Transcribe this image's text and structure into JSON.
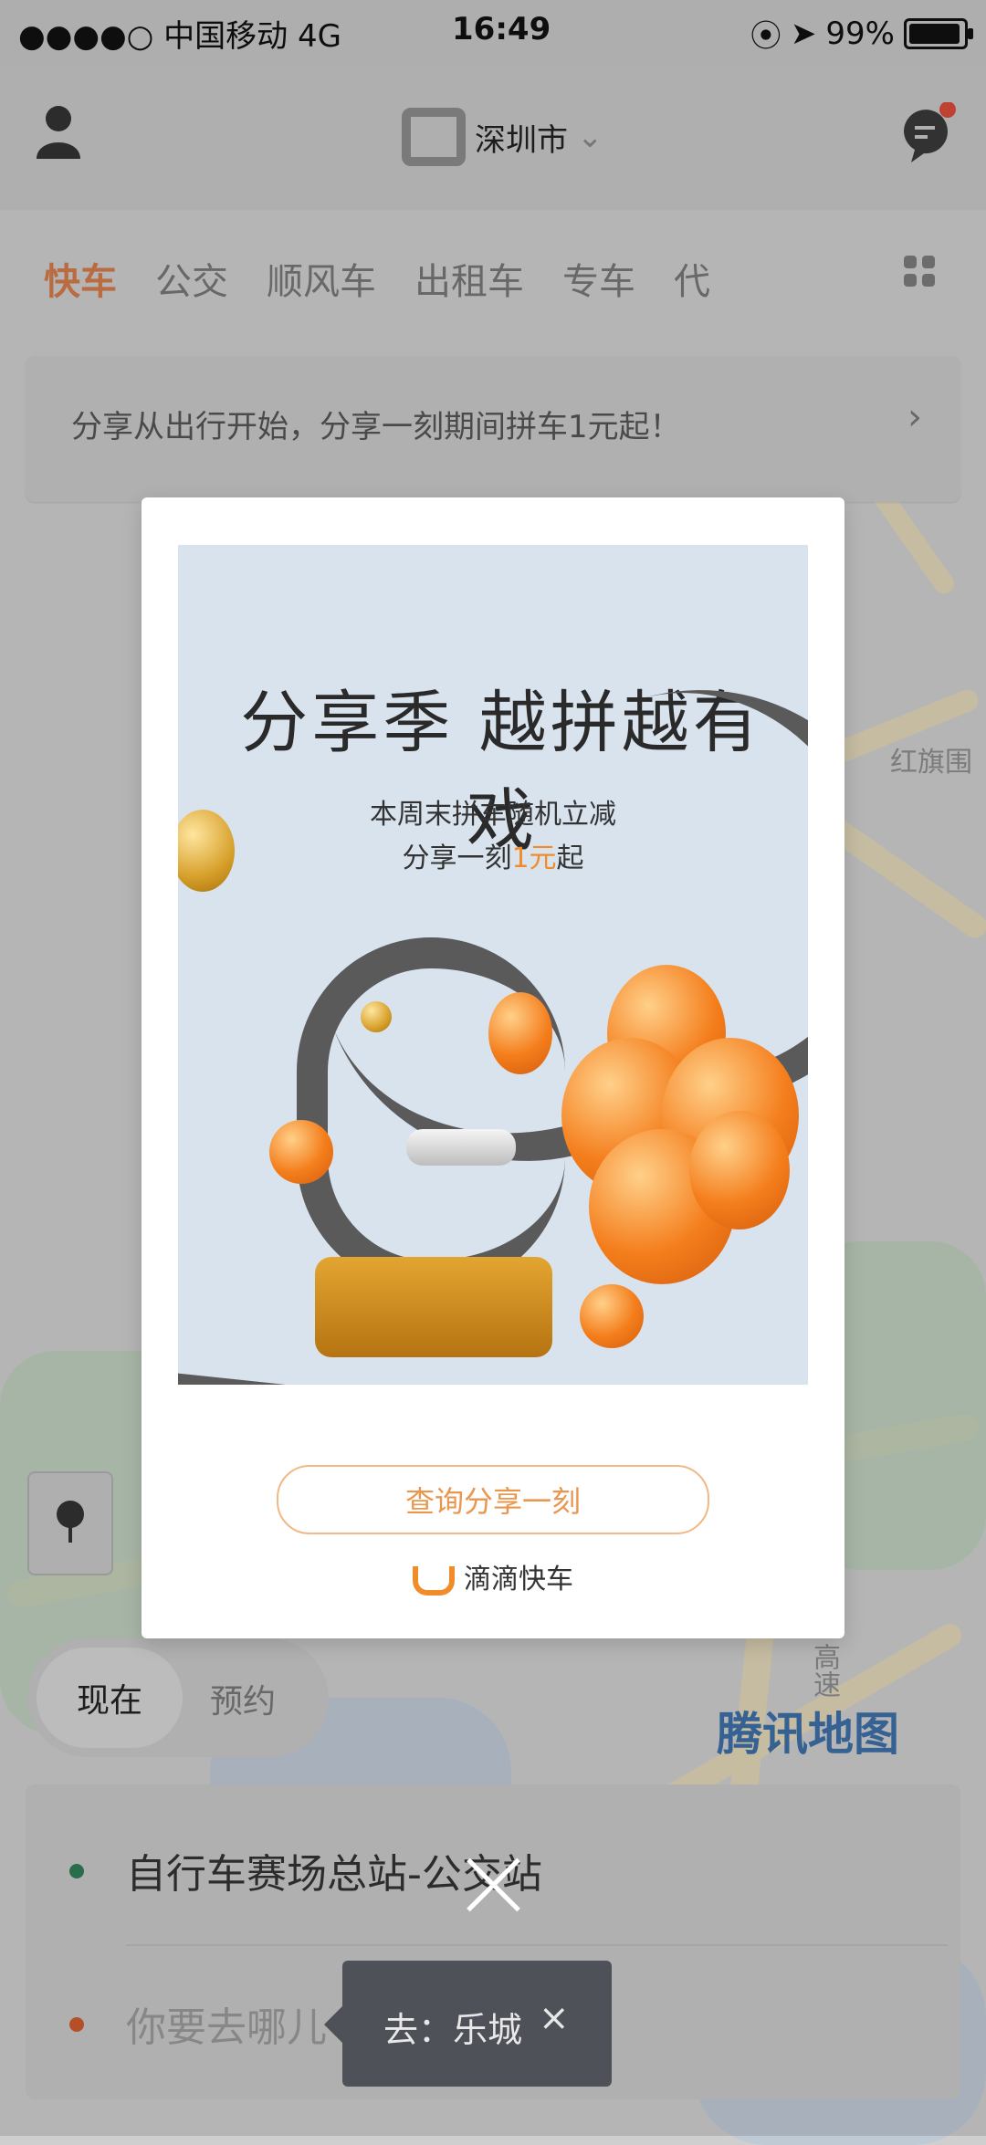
{
  "status_bar": {
    "carrier": "●●●●○ 中国移动 4G",
    "time": "16:49",
    "battery": "99%"
  },
  "header": {
    "city": "深圳市",
    "city_chevron": "⌄"
  },
  "tabs": [
    "快车",
    "公交",
    "顺风车",
    "出租车",
    "专车",
    "代"
  ],
  "promo_banner": {
    "text": "分享从出行开始，分享一刻期间拼车1元起！",
    "chevron": "›"
  },
  "modal": {
    "title": "分享季 越拼越有戏",
    "subtitle_line1": "本周末拼车随机立减",
    "subtitle_line2_prefix": "分享一刻",
    "subtitle_line2_highlight": "1元",
    "subtitle_line2_suffix": "起",
    "query_button": "查询分享一刻",
    "brand": "滴滴快车"
  },
  "map": {
    "label_hongqi": "红旗围",
    "label_gaosu": "高速",
    "brand": "腾讯地图"
  },
  "time_toggle": {
    "now": "现在",
    "reserve": "预约"
  },
  "address_panel": {
    "origin": "自行车赛场总站-公交站",
    "destination_placeholder": "你要去哪儿"
  },
  "toast": {
    "text": "去：乐城",
    "close": "×"
  },
  "colors": {
    "accent_orange": "#d37b4a",
    "origin_green": "#2e7d57",
    "dest_orange": "#cf5b2d"
  }
}
